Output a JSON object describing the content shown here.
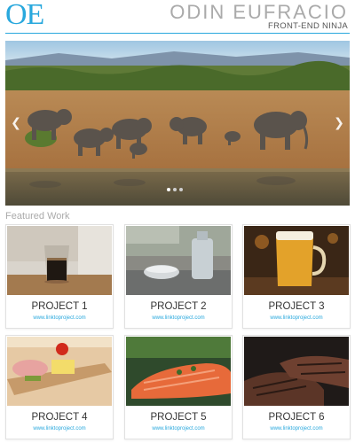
{
  "header": {
    "logo": "OE",
    "site_title": "ODIN EUFRACIO",
    "tagline": "FRONT-END NINJA"
  },
  "carousel": {
    "prev_icon": "chevron-left-icon",
    "next_icon": "chevron-right-icon",
    "slide_count": 3,
    "active_slide": 1
  },
  "featured": {
    "heading": "Featured Work",
    "projects": [
      {
        "name": "PROJECT 1",
        "link": "www.linktoproject.com"
      },
      {
        "name": "PROJECT 2",
        "link": "www.linktoproject.com"
      },
      {
        "name": "PROJECT 3",
        "link": "www.linktoproject.com"
      },
      {
        "name": "PROJECT 4",
        "link": "www.linktoproject.com"
      },
      {
        "name": "PROJECT 5",
        "link": "www.linktoproject.com"
      },
      {
        "name": "PROJECT 6",
        "link": "www.linktoproject.com"
      }
    ]
  },
  "colors": {
    "accent": "#29a8dd",
    "muted_text": "#aaaaaa"
  }
}
